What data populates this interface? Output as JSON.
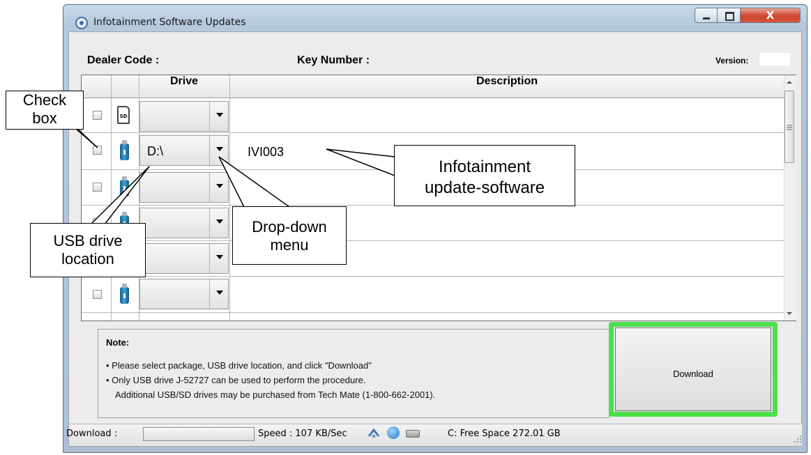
{
  "window": {
    "title": "Infotainment Software Updates",
    "close_glyph": "X"
  },
  "header": {
    "dealer_code_label": "Dealer Code :",
    "key_number_label": "Key Number :",
    "version_label": "Version:"
  },
  "grid": {
    "columns": [
      "Drive",
      "Description"
    ],
    "rows": [
      {
        "icon": "sd-card-icon",
        "drive": "",
        "description": ""
      },
      {
        "icon": "usb-drive-icon",
        "drive": "D:\\",
        "description": "IVI003"
      },
      {
        "icon": "usb-drive-icon",
        "drive": "",
        "description": ""
      },
      {
        "icon": "usb-drive-icon",
        "drive": "",
        "description": ""
      },
      {
        "icon": "usb-drive-icon",
        "drive": "",
        "description": ""
      },
      {
        "icon": "usb-drive-icon",
        "drive": "",
        "description": ""
      }
    ]
  },
  "note": {
    "title": "Note:",
    "lines": [
      "• Please select package, USB drive location, and click \"Download\"",
      "• Only USB drive J-52727 can be used to perform the procedure.",
      "Additional USB/SD drives may be purchased from Tech Mate (1-800-662-2001)."
    ]
  },
  "download_button": {
    "label": "Download",
    "highlight_color": "#4be04b"
  },
  "status": {
    "download_label": "Download :",
    "speed": "Speed :  107 KB/Sec",
    "free_space": "C: Free Space 272.01 GB"
  },
  "callouts": {
    "check_box": [
      "Check",
      "box"
    ],
    "usb_drive_location": [
      "USB drive",
      "location"
    ],
    "drop_down_menu": [
      "Drop-down",
      "menu"
    ],
    "infotainment_update_software": [
      "Infotainment",
      "update-software"
    ]
  }
}
